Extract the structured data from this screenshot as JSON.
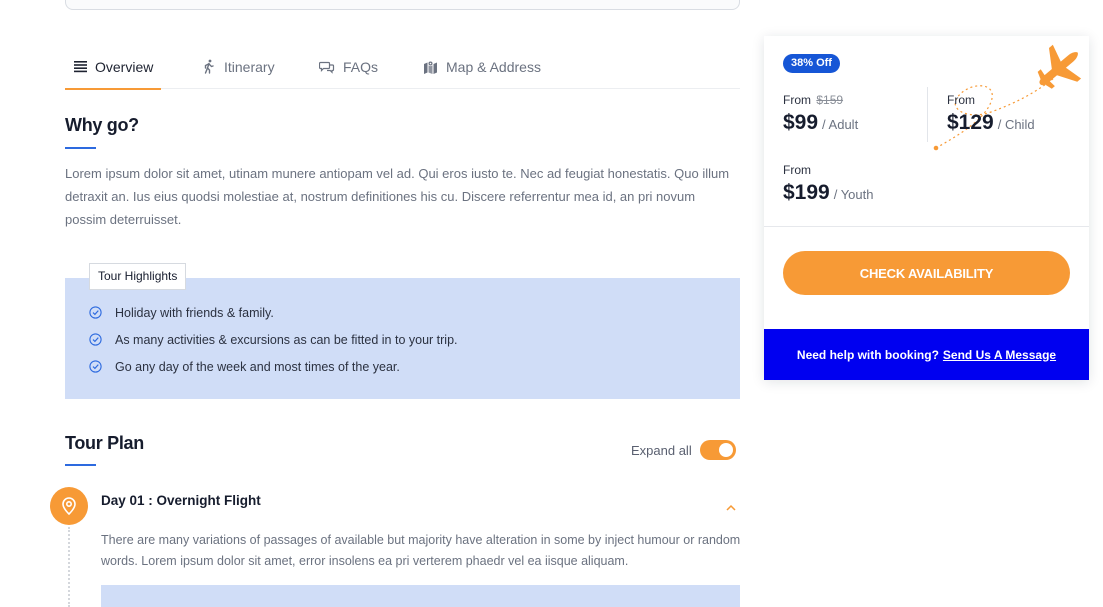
{
  "tabs": [
    {
      "label": "Overview",
      "icon": "list-icon",
      "active": true
    },
    {
      "label": "Itinerary",
      "icon": "hiker-icon",
      "active": false
    },
    {
      "label": "FAQs",
      "icon": "chat-icon",
      "active": false
    },
    {
      "label": "Map & Address",
      "icon": "map-icon",
      "active": false
    }
  ],
  "why_go": {
    "title": "Why go?",
    "text": "Lorem ipsum dolor sit amet, utinam munere antiopam vel ad. Qui eros iusto te. Nec ad feugiat honestatis. Quo illum detraxit an. Ius eius quodsi molestiae at, nostrum definitiones his cu. Discere referrentur mea id, an pri novum possim deterruisset."
  },
  "highlights": {
    "tag": "Tour Highlights",
    "items": [
      "Holiday with friends & family.",
      "As many activities & excursions as can be fitted in to your trip.",
      "Go any day of the week and most times of the year."
    ]
  },
  "tour_plan": {
    "title": "Tour Plan",
    "expand_label": "Expand all",
    "expand_on": true,
    "days": [
      {
        "title": "Day 01 : Overnight Flight",
        "text": "There are many variations of passages of available but majority have alteration in some by inject humour or random words. Lorem ipsum dolor sit amet, error insolens ea pri verterem phaedr vel ea iisque aliquam."
      }
    ]
  },
  "booking": {
    "badge": "38% Off",
    "prices": [
      {
        "from": "From",
        "old": "$159",
        "amount": "$99",
        "unit": "/ Adult"
      },
      {
        "from": "From",
        "old": "",
        "amount": "$129",
        "unit": "/ Child"
      },
      {
        "from": "From",
        "old": "",
        "amount": "$199",
        "unit": "/ Youth"
      }
    ],
    "cta_label": "CHECK AVAILABILITY",
    "help_text": "Need help with booking?",
    "help_link": "Send Us A Message"
  },
  "colors": {
    "accent": "#f79a36",
    "primary_blue": "#1656d6",
    "help_bar": "#0000f0",
    "highlight_bg": "#d0ddf7"
  }
}
